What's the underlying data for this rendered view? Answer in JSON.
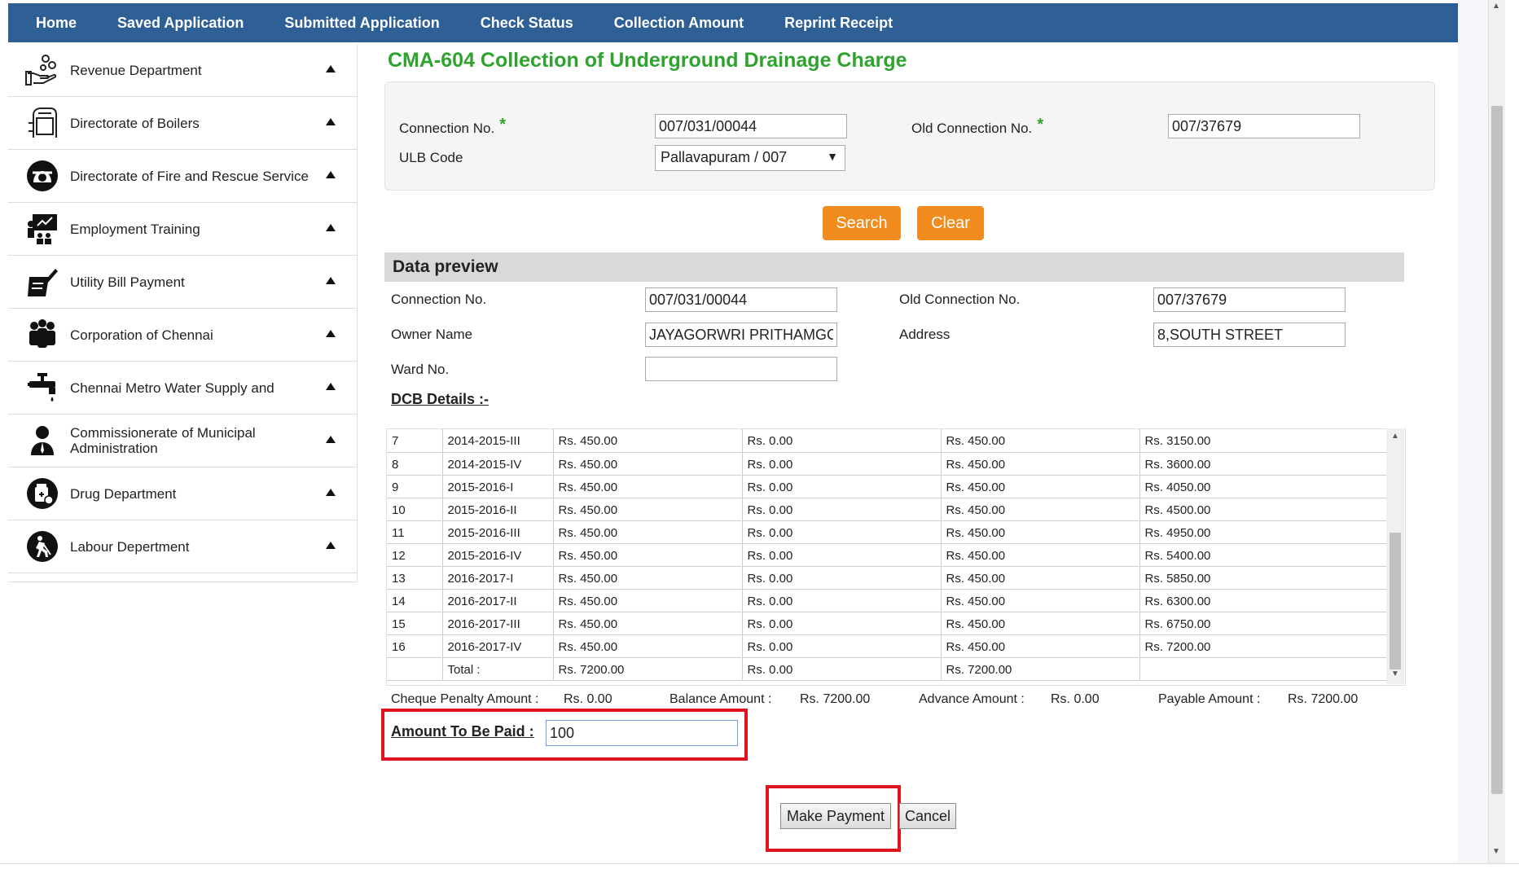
{
  "nav": {
    "items": [
      "Home",
      "Saved Application",
      "Submitted Application",
      "Check Status",
      "Collection Amount",
      "Reprint Receipt"
    ]
  },
  "sidebar": {
    "items": [
      {
        "label": "Revenue Department",
        "icon": "hand-coins-icon"
      },
      {
        "label": "Directorate of Boilers",
        "icon": "boiler-icon"
      },
      {
        "label": "Directorate of Fire and Rescue Service",
        "icon": "firefighter-icon"
      },
      {
        "label": "Employment Training",
        "icon": "classroom-icon"
      },
      {
        "label": "Utility Bill Payment",
        "icon": "bill-pen-icon"
      },
      {
        "label": "Corporation of Chennai",
        "icon": "people-group-icon"
      },
      {
        "label": "Chennai Metro Water Supply and",
        "icon": "water-tap-icon"
      },
      {
        "label": "Commissionerate of Municipal Administration",
        "icon": "officer-icon"
      },
      {
        "label": "Drug Department",
        "icon": "medicine-icon"
      },
      {
        "label": "Labour Depertment",
        "icon": "worker-icon"
      }
    ]
  },
  "page": {
    "title": "CMA-604 Collection of Underground Drainage Charge"
  },
  "search": {
    "connection_label": "Connection No.",
    "connection_value": "007/031/00044",
    "old_connection_label": "Old Connection No.",
    "old_connection_value": "007/37679",
    "ulb_label": "ULB Code",
    "ulb_value": "Pallavapuram / 007",
    "required_mark": "*",
    "search_button": "Search",
    "clear_button": "Clear"
  },
  "preview": {
    "heading": "Data preview",
    "connection_label": "Connection No.",
    "connection_value": "007/031/00044",
    "old_connection_label": "Old Connection No.",
    "old_connection_value": "007/37679",
    "owner_label": "Owner Name",
    "owner_value": "JAYAGORWRI PRITHAMGC",
    "address_label": "Address",
    "address_value": "8,SOUTH STREET",
    "ward_label": "Ward No.",
    "ward_value": ""
  },
  "dcb": {
    "title": "DCB Details :-",
    "rows": [
      [
        "7",
        "2014-2015-III",
        "Rs. 450.00",
        "Rs. 0.00",
        "Rs. 450.00",
        "Rs. 3150.00"
      ],
      [
        "8",
        "2014-2015-IV",
        "Rs. 450.00",
        "Rs. 0.00",
        "Rs. 450.00",
        "Rs. 3600.00"
      ],
      [
        "9",
        "2015-2016-I",
        "Rs. 450.00",
        "Rs. 0.00",
        "Rs. 450.00",
        "Rs. 4050.00"
      ],
      [
        "10",
        "2015-2016-II",
        "Rs. 450.00",
        "Rs. 0.00",
        "Rs. 450.00",
        "Rs. 4500.00"
      ],
      [
        "11",
        "2015-2016-III",
        "Rs. 450.00",
        "Rs. 0.00",
        "Rs. 450.00",
        "Rs. 4950.00"
      ],
      [
        "12",
        "2015-2016-IV",
        "Rs. 450.00",
        "Rs. 0.00",
        "Rs. 450.00",
        "Rs. 5400.00"
      ],
      [
        "13",
        "2016-2017-I",
        "Rs. 450.00",
        "Rs. 0.00",
        "Rs. 450.00",
        "Rs. 5850.00"
      ],
      [
        "14",
        "2016-2017-II",
        "Rs. 450.00",
        "Rs. 0.00",
        "Rs. 450.00",
        "Rs. 6300.00"
      ],
      [
        "15",
        "2016-2017-III",
        "Rs. 450.00",
        "Rs. 0.00",
        "Rs. 450.00",
        "Rs. 6750.00"
      ],
      [
        "16",
        "2016-2017-IV",
        "Rs. 450.00",
        "Rs. 0.00",
        "Rs. 450.00",
        "Rs. 7200.00"
      ],
      [
        "",
        "Total :",
        "Rs. 7200.00",
        "Rs. 0.00",
        "Rs. 7200.00",
        ""
      ]
    ]
  },
  "summary": {
    "cheque_penalty_label": "Cheque Penalty Amount :",
    "cheque_penalty_value": "Rs. 0.00",
    "balance_label": "Balance Amount :",
    "balance_value": "Rs. 7200.00",
    "advance_label": "Advance Amount :",
    "advance_value": "Rs. 0.00",
    "payable_label": "Payable Amount :",
    "payable_value": "Rs. 7200.00"
  },
  "payment": {
    "amount_label": "Amount To Be Paid :",
    "amount_value": "100",
    "make_payment_button": "Make Payment",
    "cancel_button": "Cancel"
  },
  "colors": {
    "nav_bg": "#2f6095",
    "title_green": "#2ea32e",
    "button_orange": "#f28c1e",
    "highlight_red": "#e0141e"
  }
}
